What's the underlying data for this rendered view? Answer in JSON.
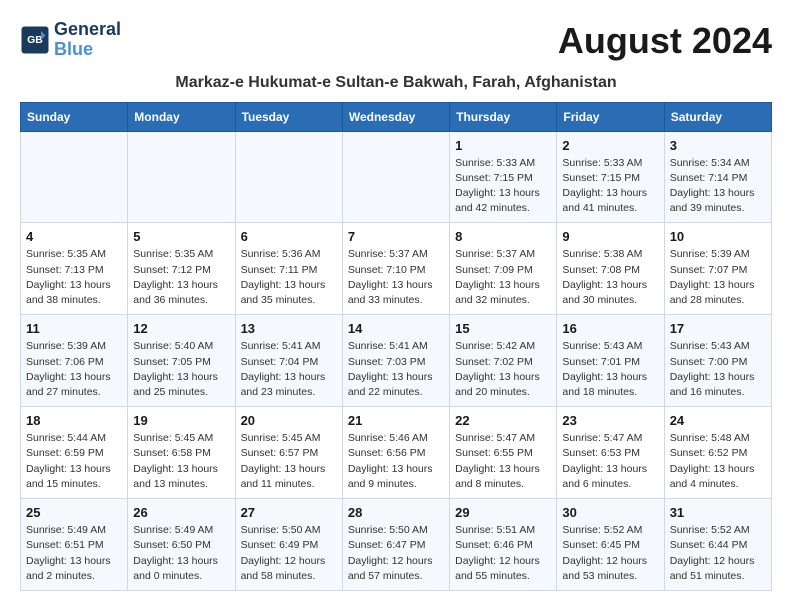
{
  "logo": {
    "line1": "General",
    "line2": "Blue"
  },
  "title": "August 2024",
  "location": "Markaz-e Hukumat-e Sultan-e Bakwah, Farah, Afghanistan",
  "days_of_week": [
    "Sunday",
    "Monday",
    "Tuesday",
    "Wednesday",
    "Thursday",
    "Friday",
    "Saturday"
  ],
  "weeks": [
    [
      {
        "day": "",
        "info": ""
      },
      {
        "day": "",
        "info": ""
      },
      {
        "day": "",
        "info": ""
      },
      {
        "day": "",
        "info": ""
      },
      {
        "day": "1",
        "info": "Sunrise: 5:33 AM\nSunset: 7:15 PM\nDaylight: 13 hours\nand 42 minutes."
      },
      {
        "day": "2",
        "info": "Sunrise: 5:33 AM\nSunset: 7:15 PM\nDaylight: 13 hours\nand 41 minutes."
      },
      {
        "day": "3",
        "info": "Sunrise: 5:34 AM\nSunset: 7:14 PM\nDaylight: 13 hours\nand 39 minutes."
      }
    ],
    [
      {
        "day": "4",
        "info": "Sunrise: 5:35 AM\nSunset: 7:13 PM\nDaylight: 13 hours\nand 38 minutes."
      },
      {
        "day": "5",
        "info": "Sunrise: 5:35 AM\nSunset: 7:12 PM\nDaylight: 13 hours\nand 36 minutes."
      },
      {
        "day": "6",
        "info": "Sunrise: 5:36 AM\nSunset: 7:11 PM\nDaylight: 13 hours\nand 35 minutes."
      },
      {
        "day": "7",
        "info": "Sunrise: 5:37 AM\nSunset: 7:10 PM\nDaylight: 13 hours\nand 33 minutes."
      },
      {
        "day": "8",
        "info": "Sunrise: 5:37 AM\nSunset: 7:09 PM\nDaylight: 13 hours\nand 32 minutes."
      },
      {
        "day": "9",
        "info": "Sunrise: 5:38 AM\nSunset: 7:08 PM\nDaylight: 13 hours\nand 30 minutes."
      },
      {
        "day": "10",
        "info": "Sunrise: 5:39 AM\nSunset: 7:07 PM\nDaylight: 13 hours\nand 28 minutes."
      }
    ],
    [
      {
        "day": "11",
        "info": "Sunrise: 5:39 AM\nSunset: 7:06 PM\nDaylight: 13 hours\nand 27 minutes."
      },
      {
        "day": "12",
        "info": "Sunrise: 5:40 AM\nSunset: 7:05 PM\nDaylight: 13 hours\nand 25 minutes."
      },
      {
        "day": "13",
        "info": "Sunrise: 5:41 AM\nSunset: 7:04 PM\nDaylight: 13 hours\nand 23 minutes."
      },
      {
        "day": "14",
        "info": "Sunrise: 5:41 AM\nSunset: 7:03 PM\nDaylight: 13 hours\nand 22 minutes."
      },
      {
        "day": "15",
        "info": "Sunrise: 5:42 AM\nSunset: 7:02 PM\nDaylight: 13 hours\nand 20 minutes."
      },
      {
        "day": "16",
        "info": "Sunrise: 5:43 AM\nSunset: 7:01 PM\nDaylight: 13 hours\nand 18 minutes."
      },
      {
        "day": "17",
        "info": "Sunrise: 5:43 AM\nSunset: 7:00 PM\nDaylight: 13 hours\nand 16 minutes."
      }
    ],
    [
      {
        "day": "18",
        "info": "Sunrise: 5:44 AM\nSunset: 6:59 PM\nDaylight: 13 hours\nand 15 minutes."
      },
      {
        "day": "19",
        "info": "Sunrise: 5:45 AM\nSunset: 6:58 PM\nDaylight: 13 hours\nand 13 minutes."
      },
      {
        "day": "20",
        "info": "Sunrise: 5:45 AM\nSunset: 6:57 PM\nDaylight: 13 hours\nand 11 minutes."
      },
      {
        "day": "21",
        "info": "Sunrise: 5:46 AM\nSunset: 6:56 PM\nDaylight: 13 hours\nand 9 minutes."
      },
      {
        "day": "22",
        "info": "Sunrise: 5:47 AM\nSunset: 6:55 PM\nDaylight: 13 hours\nand 8 minutes."
      },
      {
        "day": "23",
        "info": "Sunrise: 5:47 AM\nSunset: 6:53 PM\nDaylight: 13 hours\nand 6 minutes."
      },
      {
        "day": "24",
        "info": "Sunrise: 5:48 AM\nSunset: 6:52 PM\nDaylight: 13 hours\nand 4 minutes."
      }
    ],
    [
      {
        "day": "25",
        "info": "Sunrise: 5:49 AM\nSunset: 6:51 PM\nDaylight: 13 hours\nand 2 minutes."
      },
      {
        "day": "26",
        "info": "Sunrise: 5:49 AM\nSunset: 6:50 PM\nDaylight: 13 hours\nand 0 minutes."
      },
      {
        "day": "27",
        "info": "Sunrise: 5:50 AM\nSunset: 6:49 PM\nDaylight: 12 hours\nand 58 minutes."
      },
      {
        "day": "28",
        "info": "Sunrise: 5:50 AM\nSunset: 6:47 PM\nDaylight: 12 hours\nand 57 minutes."
      },
      {
        "day": "29",
        "info": "Sunrise: 5:51 AM\nSunset: 6:46 PM\nDaylight: 12 hours\nand 55 minutes."
      },
      {
        "day": "30",
        "info": "Sunrise: 5:52 AM\nSunset: 6:45 PM\nDaylight: 12 hours\nand 53 minutes."
      },
      {
        "day": "31",
        "info": "Sunrise: 5:52 AM\nSunset: 6:44 PM\nDaylight: 12 hours\nand 51 minutes."
      }
    ]
  ]
}
